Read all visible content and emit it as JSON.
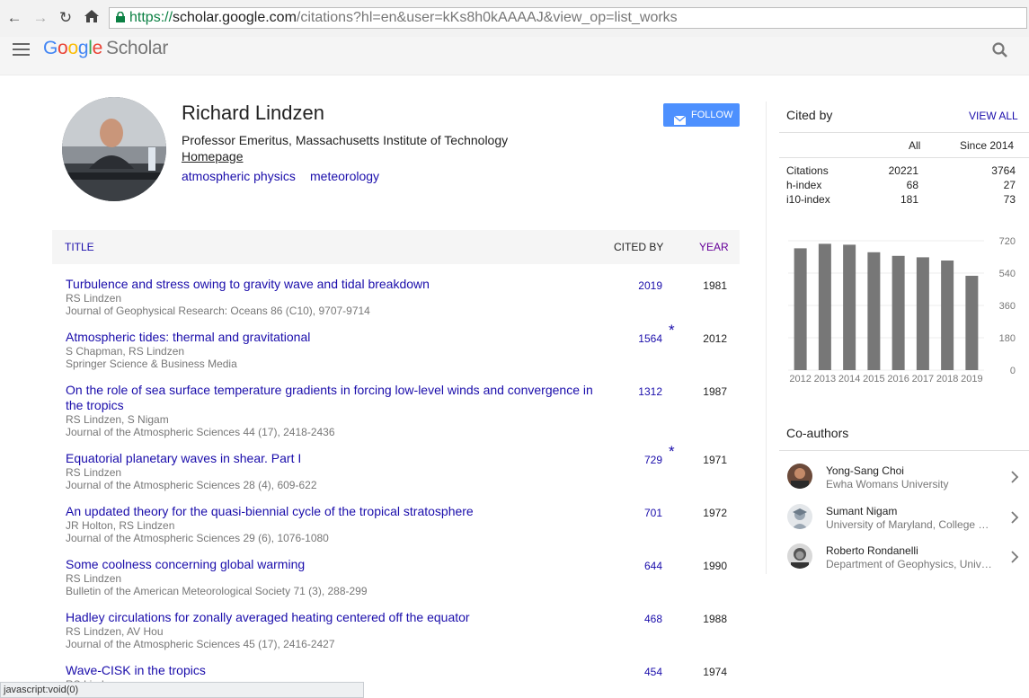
{
  "browser": {
    "url_secure": "https://",
    "url_host": "scholar.google.com",
    "url_path": "/citations?hl=en&user=kKs8h0kAAAAJ&view_op=list_works",
    "status_text": "javascript:void(0)"
  },
  "header": {
    "logo_letters": [
      "G",
      "o",
      "o",
      "g",
      "l",
      "e"
    ],
    "logo_scholar": "Scholar"
  },
  "profile": {
    "name": "Richard Lindzen",
    "affiliation": "Professor Emeritus, Massachusetts Institute of Technology",
    "homepage": "Homepage",
    "interests": [
      "atmospheric physics",
      "meteorology"
    ],
    "follow_label": "FOLLOW"
  },
  "table": {
    "col_title": "TITLE",
    "col_cited": "CITED BY",
    "col_year": "YEAR",
    "rows": [
      {
        "title": "Turbulence and stress owing to gravity wave and tidal breakdown",
        "authors": "RS Lindzen",
        "venue": "Journal of Geophysical Research: Oceans 86 (C10), 9707-9714",
        "cited": "2019",
        "star": "",
        "year": "1981"
      },
      {
        "title": "Atmospheric tides: thermal and gravitational",
        "authors": "S Chapman, RS Lindzen",
        "venue": "Springer Science & Business Media",
        "cited": "1564",
        "star": "*",
        "year": "2012"
      },
      {
        "title": "On the role of sea surface temperature gradients in forcing low-level winds and convergence in the tropics",
        "authors": "RS Lindzen, S Nigam",
        "venue": "Journal of the Atmospheric Sciences 44 (17), 2418-2436",
        "cited": "1312",
        "star": "",
        "year": "1987"
      },
      {
        "title": "Equatorial planetary waves in shear. Part I",
        "authors": "RS Lindzen",
        "venue": "Journal of the Atmospheric Sciences 28 (4), 609-622",
        "cited": "729",
        "star": "*",
        "year": "1971"
      },
      {
        "title": "An updated theory for the quasi-biennial cycle of the tropical stratosphere",
        "authors": "JR Holton, RS Lindzen",
        "venue": "Journal of the Atmospheric Sciences 29 (6), 1076-1080",
        "cited": "701",
        "star": "",
        "year": "1972"
      },
      {
        "title": "Some coolness concerning global warming",
        "authors": "RS Lindzen",
        "venue": "Bulletin of the American Meteorological Society 71 (3), 288-299",
        "cited": "644",
        "star": "",
        "year": "1990"
      },
      {
        "title": "Hadley circulations for zonally averaged heating centered off the equator",
        "authors": "RS Lindzen, AV Hou",
        "venue": "Journal of the Atmospheric Sciences 45 (17), 2416-2427",
        "cited": "468",
        "star": "",
        "year": "1988"
      },
      {
        "title": "Wave-CISK in the tropics",
        "authors": "RS Lindzen",
        "venue": "",
        "cited": "454",
        "star": "",
        "year": "1974"
      }
    ]
  },
  "cited_by": {
    "title": "Cited by",
    "view_all": "VIEW ALL",
    "col_all": "All",
    "col_since": "Since 2014",
    "stats": [
      {
        "label": "Citations",
        "all": "20221",
        "since": "3764"
      },
      {
        "label": "h-index",
        "all": "68",
        "since": "27"
      },
      {
        "label": "i10-index",
        "all": "181",
        "since": "73"
      }
    ]
  },
  "chart_data": {
    "type": "bar",
    "categories": [
      "2012",
      "2013",
      "2014",
      "2015",
      "2016",
      "2017",
      "2018",
      "2019"
    ],
    "values": [
      678,
      703,
      698,
      656,
      636,
      628,
      610,
      525
    ],
    "ylim": [
      0,
      720
    ],
    "yticks": [
      "0",
      "180",
      "360",
      "540",
      "720"
    ],
    "bar_color": "#777777"
  },
  "coauthors": {
    "title": "Co-authors",
    "items": [
      {
        "name": "Yong-Sang Choi",
        "affiliation": "Ewha Womans University"
      },
      {
        "name": "Sumant Nigam",
        "affiliation": "University of Maryland, College Park"
      },
      {
        "name": "Roberto Rondanelli",
        "affiliation": "Department of Geophysics, Universidad de Chile"
      }
    ]
  },
  "colors": {
    "link": "#1a0dab",
    "follow_button": "#4d90fe",
    "logo": [
      "#4285f4",
      "#ea4335",
      "#fbbc05",
      "#4285f4",
      "#34a853",
      "#ea4335"
    ]
  }
}
